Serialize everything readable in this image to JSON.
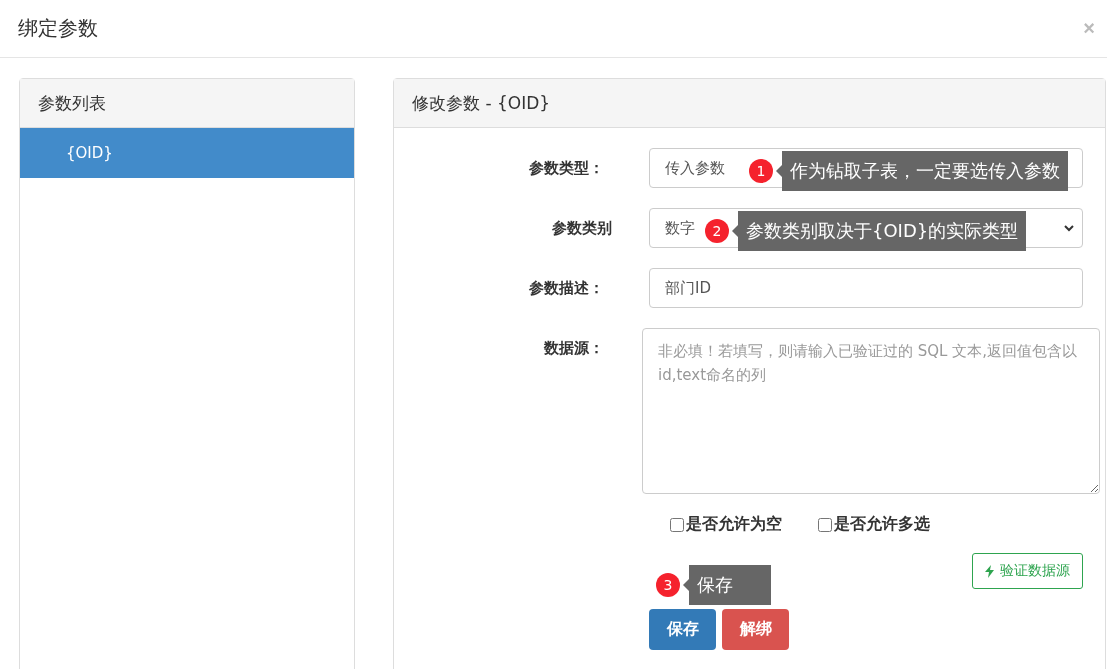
{
  "dialog": {
    "title": "绑定参数",
    "close": "×"
  },
  "param_list": {
    "title": "参数列表",
    "items": [
      {
        "label": "{OID}",
        "selected": true
      }
    ]
  },
  "edit_panel": {
    "title": "修改参数 - {OID}",
    "fields": [
      {
        "kind": "select",
        "label": "参数类型：",
        "value": "传入参数",
        "caret": false,
        "note": {
          "number": "1",
          "text": "作为钻取子表，一定要选传入参数"
        }
      },
      {
        "kind": "select",
        "label": "参数类别",
        "value": "数字",
        "caret": true,
        "note": {
          "number": "2",
          "text": "参数类别取决于{OID}的实际类型"
        }
      },
      {
        "kind": "input",
        "label": "参数描述：",
        "value": "部门ID"
      },
      {
        "kind": "textarea",
        "label": "数据源：",
        "placeholder": "非必填！若填写，则请输入已验证过的 SQL 文本,返回值包含以id,text命名的列"
      }
    ],
    "checkboxes": [
      {
        "label": "是否允许为空",
        "checked": false
      },
      {
        "label": "是否允许多选",
        "checked": false
      }
    ],
    "verify_button": "验证数据源",
    "save_note": {
      "number": "3",
      "text": "保存"
    },
    "buttons": [
      {
        "kind": "primary",
        "label": "保存"
      },
      {
        "kind": "danger",
        "label": "解绑"
      }
    ]
  }
}
